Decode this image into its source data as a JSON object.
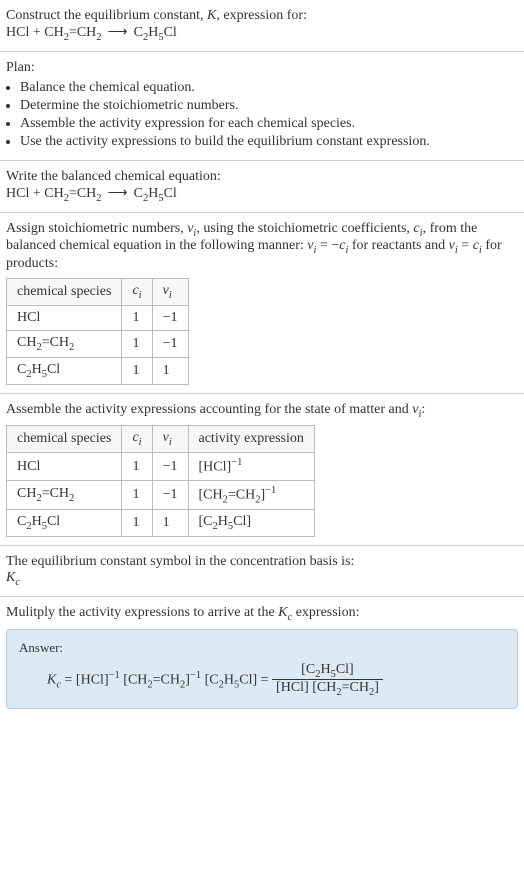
{
  "header": {
    "title_prefix": "Construct the equilibrium constant, ",
    "title_var": "K",
    "title_suffix": ", expression for:",
    "equation_lhs1": "HCl",
    "equation_plus": " + ",
    "equation_lhs2": "CH",
    "equation_lhs2_sub1": "2",
    "equation_lhs2_mid": "=CH",
    "equation_lhs2_sub2": "2",
    "equation_arrow": "⟶",
    "equation_rhs": "C",
    "equation_rhs_sub1": "2",
    "equation_rhs_mid": "H",
    "equation_rhs_sub2": "5",
    "equation_rhs_end": "Cl"
  },
  "plan": {
    "heading": "Plan:",
    "items": [
      "Balance the chemical equation.",
      "Determine the stoichiometric numbers.",
      "Assemble the activity expression for each chemical species.",
      "Use the activity expressions to build the equilibrium constant expression."
    ]
  },
  "balanced": {
    "heading": "Write the balanced chemical equation:"
  },
  "assign": {
    "text1": "Assign stoichiometric numbers, ",
    "nu": "ν",
    "sub_i": "i",
    "text2": ", using the stoichiometric coefficients, ",
    "c": "c",
    "text3": ", from the balanced chemical equation in the following manner: ",
    "eq_reactants": " = −",
    "text4": " for reactants and ",
    "eq_products": " = ",
    "text5": " for products:",
    "th_species": "chemical species",
    "th_ci": "c",
    "th_nui": "ν",
    "rows": [
      {
        "species_html": "HCl",
        "ci": "1",
        "nui": "−1"
      },
      {
        "species_html": "CH2=CH2",
        "ci": "1",
        "nui": "−1"
      },
      {
        "species_html": "C2H5Cl",
        "ci": "1",
        "nui": "1"
      }
    ]
  },
  "activity": {
    "heading_prefix": "Assemble the activity expressions accounting for the state of matter and ",
    "heading_suffix": ":",
    "th_species": "chemical species",
    "th_activity": "activity expression",
    "rows": [
      {
        "ci": "1",
        "nui": "−1"
      },
      {
        "ci": "1",
        "nui": "−1"
      },
      {
        "ci": "1",
        "nui": "1"
      }
    ]
  },
  "kc_symbol": {
    "heading": "The equilibrium constant symbol in the concentration basis is:",
    "symbol": "K",
    "symbol_sub": "c"
  },
  "multiply": {
    "heading_prefix": "Mulitply the activity expressions to arrive at the ",
    "heading_suffix": " expression:"
  },
  "answer": {
    "label": "Answer:",
    "eq": " = "
  }
}
